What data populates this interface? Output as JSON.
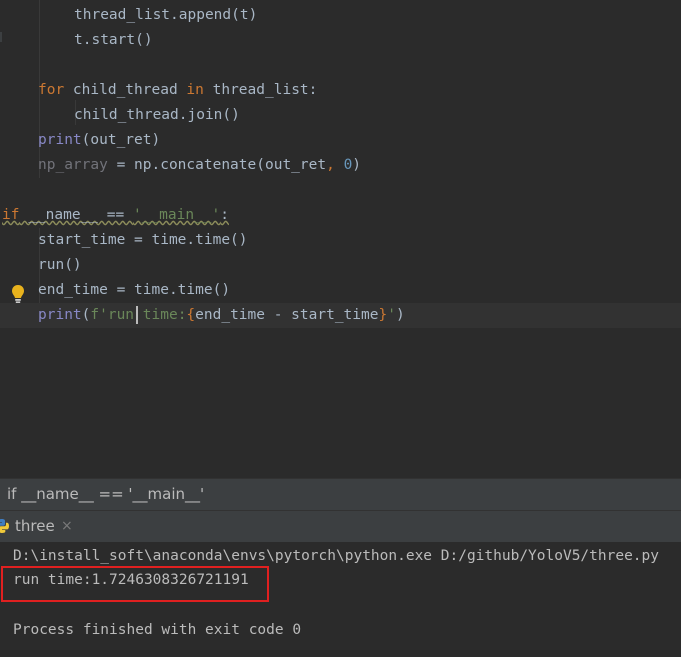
{
  "editor": {
    "lines": [
      {
        "id": "l1",
        "tokens": [
          {
            "t": "thread_list.append(t)",
            "c": ""
          }
        ]
      },
      {
        "id": "l2",
        "tokens": [
          {
            "t": "t.start()",
            "c": ""
          }
        ]
      },
      {
        "id": "l3",
        "tokens": [
          {
            "t": "for",
            "c": "kw"
          },
          {
            "t": " child_thread ",
            "c": ""
          },
          {
            "t": "in",
            "c": "kw"
          },
          {
            "t": " thread_list:",
            "c": ""
          }
        ]
      },
      {
        "id": "l4",
        "tokens": [
          {
            "t": "child_thread.join()",
            "c": ""
          }
        ]
      },
      {
        "id": "l5",
        "tokens": [
          {
            "t": "print",
            "c": "bi"
          },
          {
            "t": "(out_ret)",
            "c": ""
          }
        ]
      },
      {
        "id": "l6",
        "tokens": [
          {
            "t": "np_array",
            "c": "unused"
          },
          {
            "t": " = np.concatenate(out_ret",
            "c": ""
          },
          {
            "t": ",",
            "c": "punc"
          },
          {
            "t": " ",
            "c": ""
          },
          {
            "t": "0",
            "c": "num"
          },
          {
            "t": ")",
            "c": ""
          }
        ]
      },
      {
        "id": "l7",
        "tokens": [
          {
            "t": "if",
            "c": "kw squiggle"
          },
          {
            "t": " __name__ == ",
            "c": "squiggle"
          },
          {
            "t": "'__main__'",
            "c": "str squiggle"
          },
          {
            "t": ":",
            "c": "squiggle"
          }
        ]
      },
      {
        "id": "l8",
        "tokens": [
          {
            "t": "start_time = time.time()",
            "c": ""
          }
        ]
      },
      {
        "id": "l9",
        "tokens": [
          {
            "t": "run()",
            "c": ""
          }
        ]
      },
      {
        "id": "l10",
        "tokens": [
          {
            "t": "end_time = time.time()",
            "c": ""
          }
        ]
      },
      {
        "id": "l11",
        "tokens": [
          {
            "t": "print",
            "c": "bi"
          },
          {
            "t": "(",
            "c": ""
          },
          {
            "t": "f'run time:",
            "c": "str"
          },
          {
            "t": "{",
            "c": "fbrace"
          },
          {
            "t": "end_time - start_time",
            "c": ""
          },
          {
            "t": "}",
            "c": "fbrace"
          },
          {
            "t": "'",
            "c": "str"
          },
          {
            "t": ")",
            "c": ""
          }
        ]
      }
    ]
  },
  "breadcrumb": {
    "text": "if __name__ == '__main__'"
  },
  "run_panel": {
    "tab_label": "three",
    "close_glyph": "×",
    "command": "D:\\install_soft\\anaconda\\envs\\pytorch\\python.exe D:/github/YoloV5/three.py",
    "output": "run time:1.7246308326721191",
    "exit_message": "Process finished with exit code 0"
  },
  "colors": {
    "background": "#2b2b2b",
    "keyword": "#cc7832",
    "string": "#6a8759",
    "builtin": "#8888c6",
    "number": "#6897bb",
    "highlight_box": "#e02020"
  },
  "icons": {
    "intention": "lightbulb-icon",
    "run_tab": "python-icon"
  }
}
